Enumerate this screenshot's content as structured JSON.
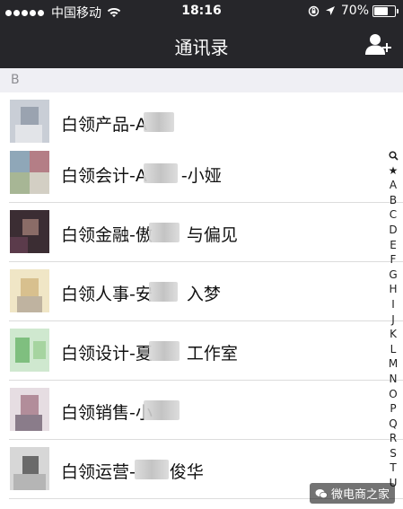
{
  "status_bar": {
    "carrier": "中国移动",
    "time": "18:16",
    "battery": "70%",
    "battery_level": 0.7,
    "signal_bars": 5
  },
  "header": {
    "title": "通讯录",
    "add_contact_icon": "add-contact-icon"
  },
  "section": {
    "letter": "B"
  },
  "contacts": [
    {
      "name": "白领产品-A"
    },
    {
      "name": "白领会计-A　　-小娅"
    },
    {
      "name": "白领金融-傲　　与偏见"
    },
    {
      "name": "白领人事-安　　入梦"
    },
    {
      "name": "白领设计-夏　　工作室"
    },
    {
      "name": "白领销售-小"
    },
    {
      "name": "白领运营-　　俊华"
    }
  ],
  "index_bar": [
    "★",
    "A",
    "B",
    "C",
    "D",
    "E",
    "F",
    "G",
    "H",
    "I",
    "J",
    "K",
    "L",
    "M",
    "N",
    "O",
    "P",
    "Q",
    "R",
    "S",
    "T",
    "U"
  ],
  "watermark": {
    "text": "微电商之家"
  },
  "colors": {
    "nav_bg": "#26262a",
    "section_bg": "#efeff4",
    "text": "#111111"
  }
}
